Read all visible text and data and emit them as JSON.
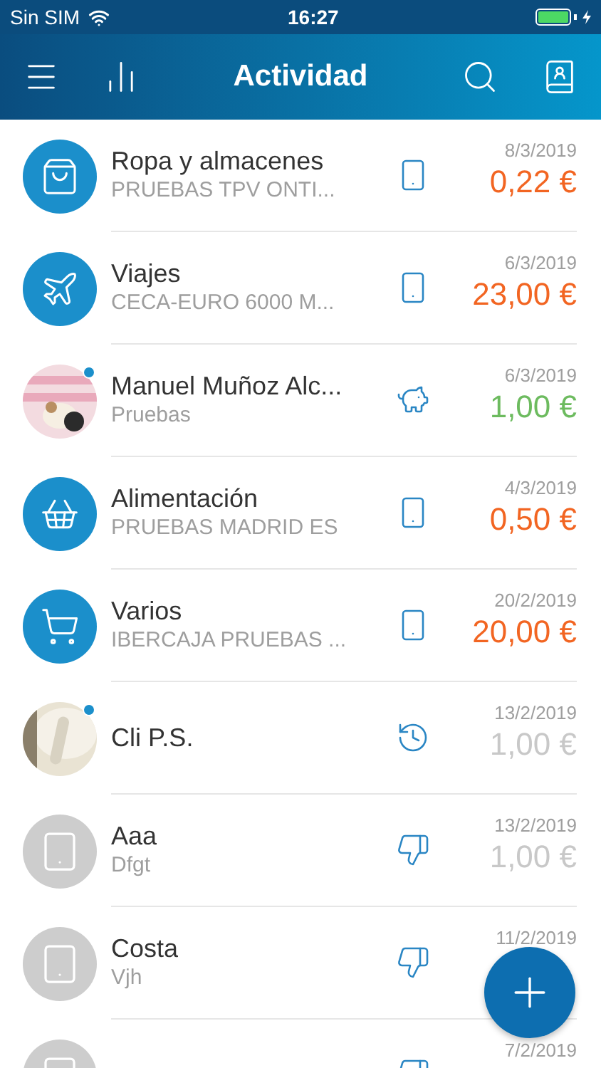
{
  "status_bar": {
    "carrier": "Sin SIM",
    "time": "16:27"
  },
  "header": {
    "title": "Actividad"
  },
  "transactions": [
    {
      "avatar": {
        "kind": "bag"
      },
      "unread": false,
      "title": "Ropa y almacenes",
      "subtitle": "PRUEBAS TPV ONTI...",
      "method": {
        "kind": "phone"
      },
      "date": "8/3/2019",
      "amount": "0,22 €",
      "color": "#f26522"
    },
    {
      "avatar": {
        "kind": "plane"
      },
      "unread": false,
      "title": "Viajes",
      "subtitle": "CECA-EURO 6000 M...",
      "method": {
        "kind": "phone"
      },
      "date": "6/3/2019",
      "amount": "23,00 €",
      "color": "#f26522"
    },
    {
      "unread": true,
      "title": "Manuel Muñoz Alc...",
      "subtitle": "Pruebas",
      "method": {
        "kind": "piggy"
      },
      "date": "6/3/2019",
      "amount": "1,00 €",
      "color": "#6dbb5f"
    },
    {
      "avatar": {
        "kind": "basket"
      },
      "unread": false,
      "title": "Alimentación",
      "subtitle": "PRUEBAS MADRID ES",
      "method": {
        "kind": "phone"
      },
      "date": "4/3/2019",
      "amount": "0,50 €",
      "color": "#f26522"
    },
    {
      "avatar": {
        "kind": "cart"
      },
      "unread": false,
      "title": "Varios",
      "subtitle": "IBERCAJA PRUEBAS ...",
      "method": {
        "kind": "phone"
      },
      "date": "20/2/2019",
      "amount": "20,00 €",
      "color": "#f26522"
    },
    {
      "unread": true,
      "title": "Cli P.S.",
      "method": {
        "kind": "clock"
      },
      "date": "13/2/2019",
      "amount": "1,00 €",
      "color": "#c8c8c8"
    },
    {
      "avatar": {
        "kind": "device"
      },
      "unread": false,
      "title": "Aaa",
      "subtitle": "Dfgt",
      "method": {
        "kind": "thumbs-down"
      },
      "date": "13/2/2019",
      "amount": "1,00 €",
      "color": "#c8c8c8"
    },
    {
      "avatar": {
        "kind": "device"
      },
      "unread": false,
      "title": "Costa",
      "subtitle": "Vjh",
      "method": {
        "kind": "thumbs-down"
      },
      "date": "11/2/2019"
    },
    {
      "avatar": {
        "kind": "device"
      },
      "unread": false,
      "method": {
        "kind": "thumbs-down"
      },
      "date": "7/2/2019"
    }
  ]
}
